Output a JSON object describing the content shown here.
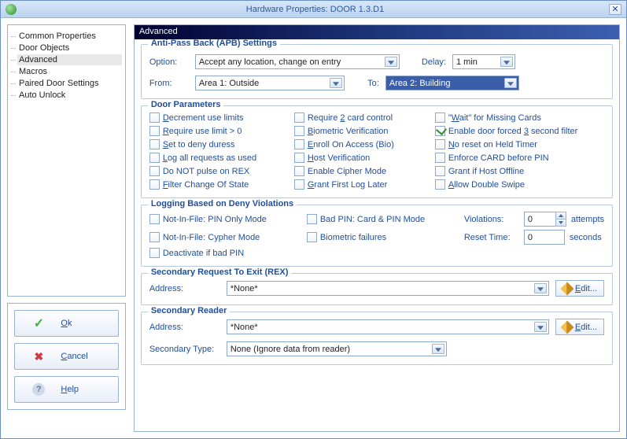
{
  "window": {
    "title": "Hardware Properties: DOOR 1.3.D1",
    "close_glyph": "✕"
  },
  "nav": {
    "items": [
      "Common Properties",
      "Door Objects",
      "Advanced",
      "Macros",
      "Paired Door Settings",
      "Auto Unlock"
    ],
    "selected_index": 2
  },
  "buttons": {
    "ok": "Ok",
    "cancel": "Cancel",
    "help": "Help"
  },
  "panel": {
    "title": "Advanced"
  },
  "apb": {
    "legend": "Anti-Pass Back (APB) Settings",
    "option_label": "Option:",
    "option_value": "Accept any location, change on entry",
    "delay_label": "Delay:",
    "delay_value": "1 min",
    "from_label": "From:",
    "from_value": "Area 1: Outside",
    "to_label": "To:",
    "to_value": "Area 2: Building"
  },
  "door_params": {
    "legend": "Door Parameters",
    "col1": [
      {
        "label": "Decrement use limits",
        "u": "D",
        "checked": false
      },
      {
        "label": "Require use limit > 0",
        "u": "R",
        "checked": false
      },
      {
        "label": "Set to deny duress",
        "u": "S",
        "checked": false
      },
      {
        "label": "Log all requests as used",
        "u": "L",
        "checked": false
      },
      {
        "label": "Do NOT pulse on REX",
        "u": "",
        "checked": false
      },
      {
        "label": "Filter Change Of State",
        "u": "F",
        "checked": false
      }
    ],
    "col2": [
      {
        "label": "Require 2 card control",
        "u": "2",
        "checked": false
      },
      {
        "label": "Biometric Verification",
        "u": "B",
        "checked": false
      },
      {
        "label": "Enroll On Access (Bio)",
        "u": "E",
        "checked": false
      },
      {
        "label": "Host Verification",
        "u": "H",
        "checked": false
      },
      {
        "label": "Enable Cipher Mode",
        "u": "",
        "checked": false
      },
      {
        "label": "Grant First Log Later",
        "u": "G",
        "checked": false
      }
    ],
    "col3": [
      {
        "label": "\"Wait\" for Missing Cards",
        "u": "W",
        "checked": false
      },
      {
        "label": "Enable door forced 3 second filter",
        "u": "3",
        "checked": true
      },
      {
        "label": "No reset on Held Timer",
        "u": "N",
        "checked": false
      },
      {
        "label": "Enforce CARD before PIN",
        "u": "",
        "checked": false
      },
      {
        "label": "Grant if Host Offline",
        "u": "",
        "checked": false
      },
      {
        "label": "Allow Double Swipe",
        "u": "A",
        "checked": false
      }
    ]
  },
  "logging": {
    "legend": "Logging Based on Deny Violations",
    "items_col1": [
      {
        "label": "Not-In-File: PIN Only Mode",
        "checked": false
      },
      {
        "label": "Not-In-File: Cypher Mode",
        "checked": false
      },
      {
        "label": "Deactivate if bad PIN",
        "checked": false
      }
    ],
    "items_col2": [
      {
        "label": "Bad PIN: Card & PIN Mode",
        "checked": false
      },
      {
        "label": "Biometric failures",
        "checked": false
      }
    ],
    "violations_label": "Violations:",
    "violations_value": "0",
    "violations_unit": "attempts",
    "reset_label": "Reset Time:",
    "reset_value": "0",
    "reset_unit": "seconds"
  },
  "rex": {
    "legend": "Secondary Request To Exit (REX)",
    "address_label": "Address:",
    "address_value": "*None*",
    "edit": "Edit..."
  },
  "reader": {
    "legend": "Secondary Reader",
    "address_label": "Address:",
    "address_value": "*None*",
    "edit": "Edit...",
    "type_label": "Secondary Type:",
    "type_value": "None (Ignore data from reader)"
  }
}
